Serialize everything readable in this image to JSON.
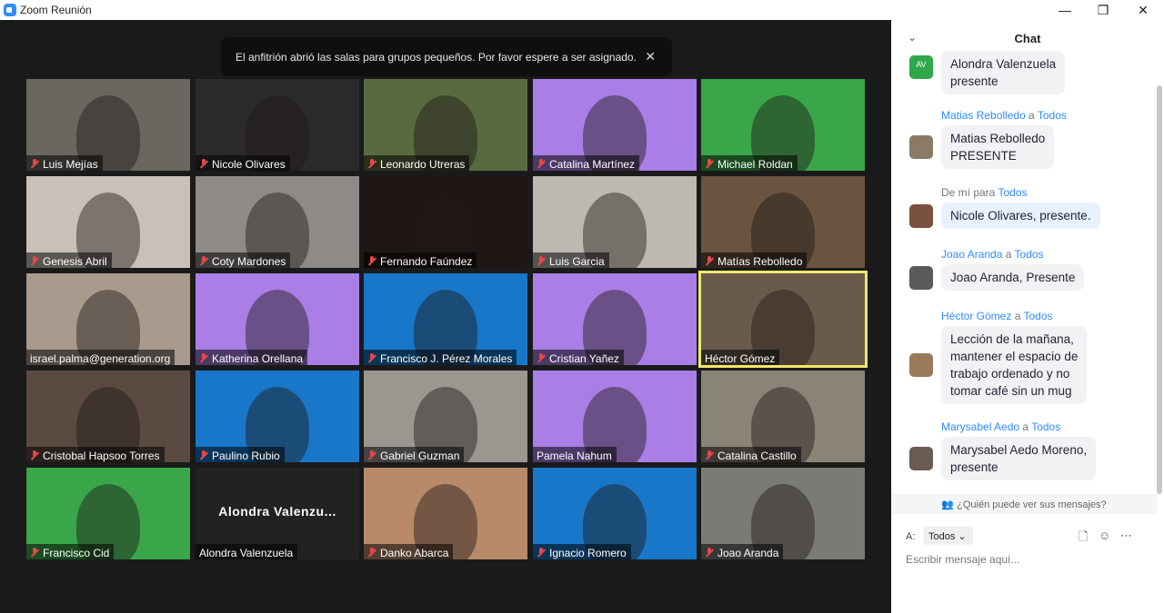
{
  "window": {
    "title": "Zoom Reunión",
    "minimize": "—",
    "restore": "❐",
    "close": "✕"
  },
  "notice": {
    "text": "El anfitrión abrió las salas para grupos pequeños. Por favor espere a ser asignado.",
    "close": "✕"
  },
  "participants": [
    {
      "name": "Luis Mejías",
      "muted": true,
      "bg": "#6a6660"
    },
    {
      "name": "Nicole Olivares",
      "muted": true,
      "bg": "#2a2a2a"
    },
    {
      "name": "Leonardo Utreras",
      "muted": true,
      "bg": "#5a6a40"
    },
    {
      "name": "Catalina Martínez",
      "muted": true,
      "bg": "#a97ee6"
    },
    {
      "name": "Michael  Roldan",
      "muted": true,
      "bg": "#3aa64a"
    },
    {
      "name": "Genesis Abril",
      "muted": true,
      "bg": "#c9c0b8"
    },
    {
      "name": "Coty Mardones",
      "muted": true,
      "bg": "#8d8a88"
    },
    {
      "name": "Fernando Faúndez",
      "muted": true,
      "bg": "#1e1614"
    },
    {
      "name": "Luis Garcia",
      "muted": true,
      "bg": "#bdb8b0"
    },
    {
      "name": "Matías Rebolledo",
      "muted": true,
      "bg": "#6a5440"
    },
    {
      "name": "israel.palma@generation.org",
      "muted": false,
      "bg": "#a89a8c"
    },
    {
      "name": "Katherina Orellana",
      "muted": true,
      "bg": "#a97ee6"
    },
    {
      "name": "Francisco J. Pérez Morales",
      "muted": true,
      "bg": "#1877c8"
    },
    {
      "name": "Cristian Yañez",
      "muted": true,
      "bg": "#a97ee6"
    },
    {
      "name": "Héctor Gómez",
      "muted": false,
      "bg": "#6a5a4c"
    },
    {
      "name": "Cristobal Hapsoo Torres",
      "muted": true,
      "bg": "#5a4a42"
    },
    {
      "name": "Paulino Rubio",
      "muted": true,
      "bg": "#1877c8"
    },
    {
      "name": "Gabriel Guzman",
      "muted": true,
      "bg": "#9a9690"
    },
    {
      "name": "Pamela Nahum",
      "muted": false,
      "bg": "#a97ee6"
    },
    {
      "name": "Catalina Castillo",
      "muted": true,
      "bg": "#8a8478"
    },
    {
      "name": "Francisco Cid",
      "muted": true,
      "bg": "#3aa64a"
    },
    {
      "name": "Alondra Valenzuela",
      "muted": false,
      "bg": "#222222",
      "big": "Alondra  Valenzu..."
    },
    {
      "name": "Danko Abarca",
      "muted": true,
      "bg": "#b88a6a"
    },
    {
      "name": "Ignacio Romero",
      "muted": true,
      "bg": "#1877c8"
    },
    {
      "name": "Joao Aranda",
      "muted": true,
      "bg": "#7a7a76"
    }
  ],
  "chat": {
    "title": "Chat",
    "collapse": "⌄",
    "messages": [
      {
        "sender": "",
        "to": "",
        "text": "Alondra Valenzuela\npresente",
        "avatar": "AV",
        "avatar_color": "#2ea84a",
        "me": false
      },
      {
        "sender": "Matias Rebolledo",
        "connector": "a",
        "to": "Todos",
        "text": "Matias Rebolledo\nPRESENTE",
        "avatar": "",
        "avatar_color": "#8a7a66",
        "me": false
      },
      {
        "sender": "De mí para",
        "connector": "",
        "to": "Todos",
        "text": "Nicole Olivares, presente.",
        "avatar": "",
        "avatar_color": "#7a5040",
        "me": true
      },
      {
        "sender": "Joao Aranda",
        "connector": "a",
        "to": "Todos",
        "text": "Joao Aranda, Presente",
        "avatar": "",
        "avatar_color": "#5a5a5a",
        "me": false
      },
      {
        "sender": "Héctor Gómez",
        "connector": "a",
        "to": "Todos",
        "text": "Lección de la mañana,\nmantener el espacio de\ntrabajo ordenado y no\ntomar café sin un mug",
        "avatar": "",
        "avatar_color": "#9a7a5a",
        "me": false
      },
      {
        "sender": "Marysabel Aedo",
        "connector": "a",
        "to": "Todos",
        "text": "Marysabel Aedo Moreno,\npresente",
        "avatar": "",
        "avatar_color": "#6a5a50",
        "me": false
      }
    ],
    "who_can_see": "¿Quién puede ver sus mensajes?",
    "to_label": "A:",
    "to_value": "Todos",
    "input_placeholder": "Escribir mensaje aquí..."
  }
}
